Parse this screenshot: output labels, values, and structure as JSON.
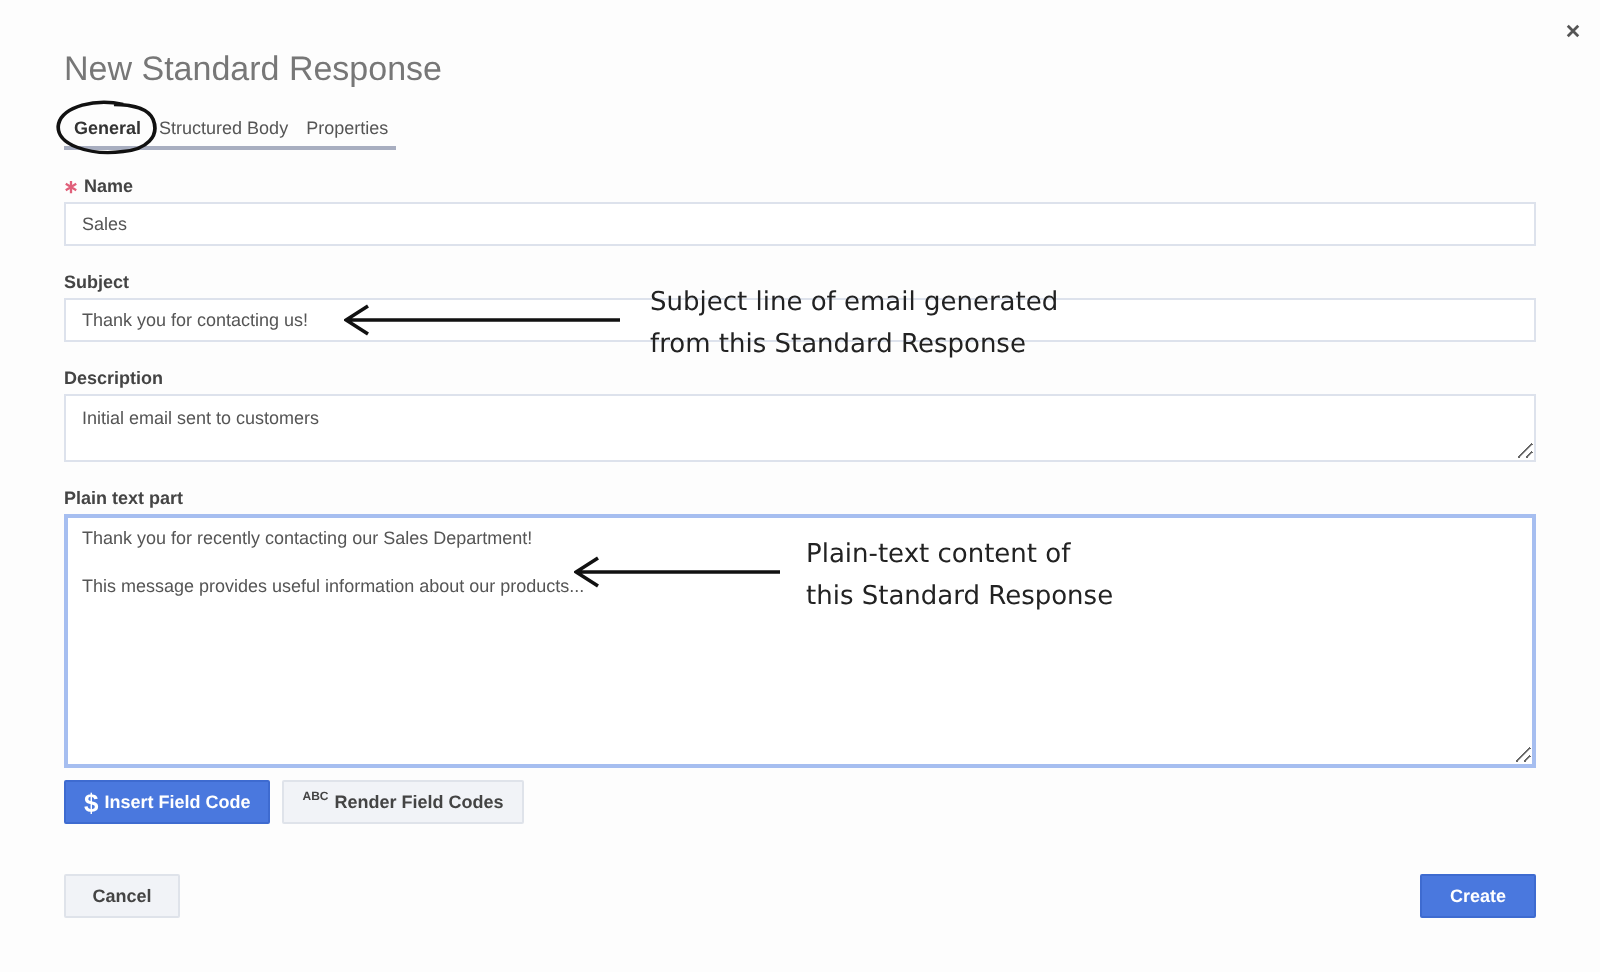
{
  "dialog": {
    "title": "New Standard Response"
  },
  "tabs": [
    {
      "label": "General",
      "selected": true
    },
    {
      "label": "Structured Body",
      "selected": false
    },
    {
      "label": "Properties",
      "selected": false
    }
  ],
  "fields": [
    {
      "label": "Name",
      "required": true,
      "kind": "input",
      "value": "Sales",
      "focused": false
    },
    {
      "label": "Subject",
      "required": false,
      "kind": "input",
      "value": "Thank you for contacting us!",
      "focused": false,
      "annotation": [
        "Subject line of email generated",
        "from this Standard Response"
      ]
    },
    {
      "label": "Description",
      "required": false,
      "kind": "textarea",
      "value": "Initial email sent to customers",
      "focused": false
    },
    {
      "label": "Plain text part",
      "required": false,
      "kind": "textarea",
      "value": "Thank you for recently contacting our Sales Department!\n\nThis message provides useful information about our products...",
      "focused": true,
      "annotation": [
        "Plain-text content of",
        "this Standard Response"
      ]
    }
  ],
  "field_buttons": [
    {
      "label": "Insert Field Code",
      "icon_text": "$",
      "kind": "primary"
    },
    {
      "label": "Render Field Codes",
      "icon_text": "ABC",
      "kind": "secondary"
    }
  ],
  "footer_buttons": [
    {
      "label": "Cancel",
      "kind": "secondary"
    },
    {
      "label": "Create",
      "kind": "primary"
    }
  ]
}
